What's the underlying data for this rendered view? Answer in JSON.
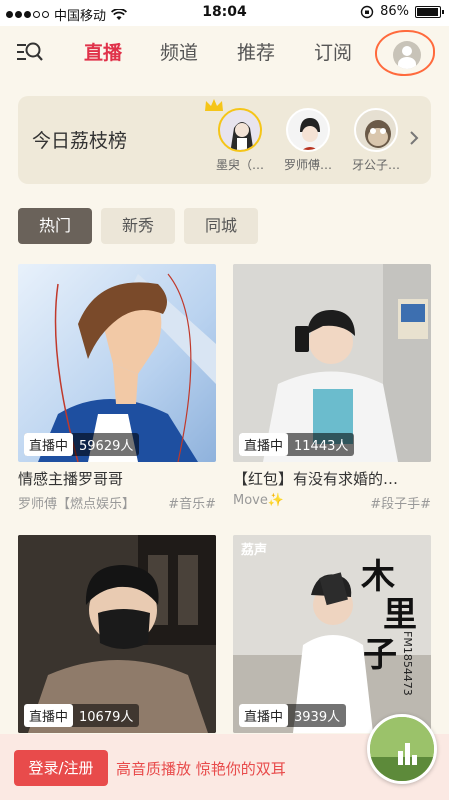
{
  "status_bar": {
    "carrier": "中国移动",
    "time": "18:04",
    "battery": "86%"
  },
  "nav": {
    "tabs": [
      "直播",
      "频道",
      "推荐",
      "订阅"
    ],
    "active_tab": "直播",
    "accent": "#e0324a"
  },
  "ranking": {
    "title": "今日荔枝榜",
    "users": [
      {
        "name": "墨臾（…"
      },
      {
        "name": "罗师傅…"
      },
      {
        "name": "牙公子…"
      }
    ]
  },
  "filters": [
    "热门",
    "新秀",
    "同城"
  ],
  "cards": [
    {
      "live_label": "直播中",
      "viewers": "59629人",
      "title": "情感主播罗哥哥",
      "author": "罗师傅【燃点娱乐】",
      "tag": "#音乐#"
    },
    {
      "live_label": "直播中",
      "viewers": "11443人",
      "title": "【红包】有没有求婚的…",
      "author": "Move✨",
      "tag": "#段子手#"
    },
    {
      "live_label": "直播中",
      "viewers": "10679人"
    },
    {
      "live_label": "直播中",
      "viewers": "3939人"
    }
  ],
  "card4_overlay": {
    "logo": "荔声",
    "big_text": [
      "木",
      "里",
      "子"
    ],
    "fm": "FM1854473"
  },
  "banner": {
    "login": "登录/注册",
    "promo": "高音质播放 惊艳你的双耳",
    "accent": "#e84b4b"
  }
}
